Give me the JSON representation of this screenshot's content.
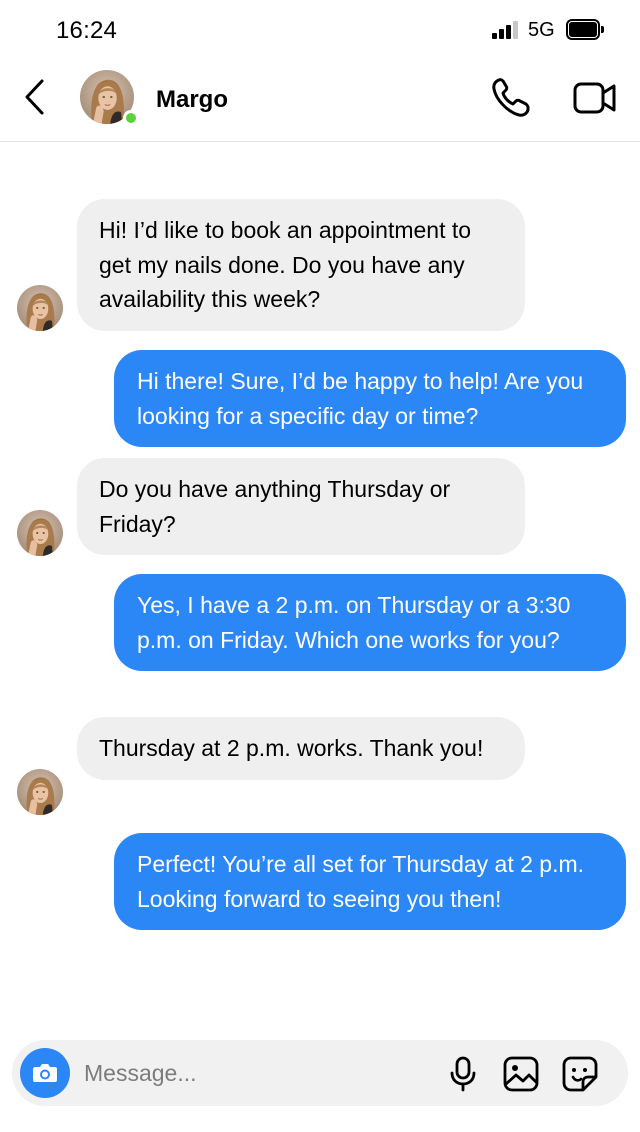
{
  "status_bar": {
    "time": "16:24",
    "network": "5G",
    "icons": [
      "cellular-signal-icon",
      "battery-icon"
    ]
  },
  "header": {
    "back_icon": "chevron-left-icon",
    "contact_name": "Margo",
    "online": true,
    "actions": [
      "phone-icon",
      "video-camera-icon"
    ]
  },
  "messages": [
    {
      "direction": "incoming",
      "text": "Hi! I’d like to book an appointment to get my nails done. Do you have any availability this week?"
    },
    {
      "direction": "outgoing",
      "text": "Hi there! Sure, I’d be happy to help! Are you looking for a specific day or time?"
    },
    {
      "direction": "incoming",
      "text": "Do you have anything Thursday or Friday?"
    },
    {
      "direction": "outgoing",
      "text": "Yes, I have a 2 p.m. on Thursday or a 3:30 p.m. on Friday. Which one works for you?"
    },
    {
      "direction": "incoming",
      "text": "Thursday at 2 p.m. works. Thank you!"
    },
    {
      "direction": "outgoing",
      "text": "Perfect! You’re all set for Thursday at 2 p.m. Looking forward to seeing you then!"
    }
  ],
  "composer": {
    "placeholder": "Message...",
    "value": "",
    "icons": [
      "camera-icon",
      "microphone-icon",
      "image-icon",
      "sticker-icon"
    ]
  },
  "colors": {
    "outgoing_bubble": "#2b87f5",
    "incoming_bubble": "#efefef",
    "online_indicator": "#5bd13a"
  }
}
